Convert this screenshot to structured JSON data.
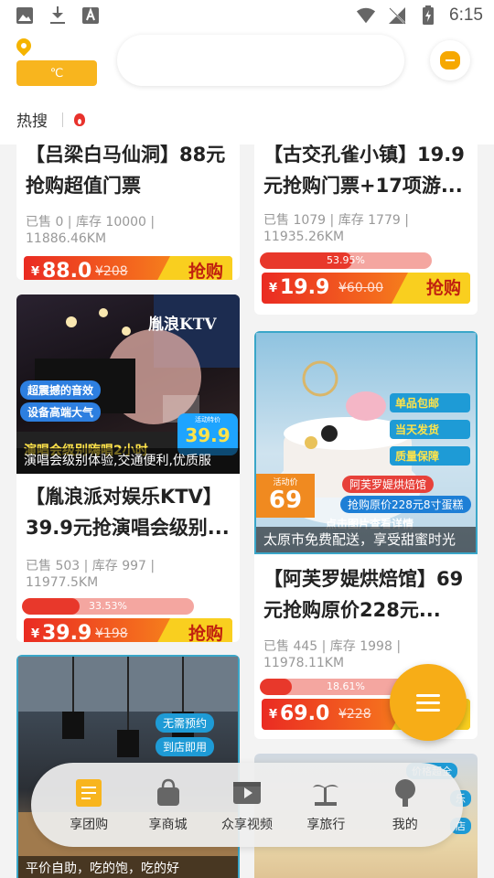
{
  "status_bar": {
    "time": "6:15"
  },
  "header": {
    "weather": "℃",
    "search_placeholder": "",
    "hot_label": "热搜"
  },
  "cards": [
    {
      "title": "【吕梁白马仙洞】88元抢购超值门票",
      "stats": "已售 0 | 库存 10000 | 11886.46KM",
      "currency": "¥",
      "price": "88.0",
      "original_price": "¥208",
      "buy_label": "抢购"
    },
    {
      "title": "【古交孔雀小镇】19.9元抢购门票+17项游...",
      "stats": "已售 1079 | 库存 1779 | 11935.26KM",
      "progress_label": "53.95%",
      "progress": 0.5395,
      "currency": "¥",
      "price": "19.9",
      "original_price": "¥60.00",
      "buy_label": "抢购"
    },
    {
      "caption": "演唱会级别体验,交通便利,优质服",
      "title": "【胤浪派对娱乐KTV】39.9元抢演唱会级别...",
      "stats": "已售 503 | 库存 997 | 11977.5KM",
      "progress_label": "33.53%",
      "progress": 0.3353,
      "currency": "¥",
      "price": "39.9",
      "original_price": "¥198",
      "buy_label": "抢购",
      "image": {
        "brand": "胤浪KTV",
        "tag1": "超震撼的音效",
        "tag2": "设备高端大气",
        "promo_label": "活动特价",
        "promo_price": "39.9",
        "bottom_text": "演唱会级别嗨唱2小时"
      }
    },
    {
      "caption": "太原市免费配送，享受甜蜜时光",
      "title": "【阿芙罗媞烘焙馆】69元抢购原价228元...",
      "stats": "已售 445 | 库存 1998 | 11978.11KM",
      "progress_label": "18.61%",
      "progress": 0.1861,
      "currency": "¥",
      "price": "69.0",
      "original_price": "¥228",
      "buy_label": "抢购",
      "image": {
        "feature1": "单品包邮",
        "feature2": "当天发货",
        "feature3": "质量保障",
        "shop_name": "阿芙罗媞烘焙馆",
        "promo_label": "活动价",
        "promo_price": "69",
        "deal_text": "抢购原价228元8寸蛋糕",
        "cta_text": "点击图片查看详情"
      }
    },
    {
      "caption": "平价自助，吃的饱，吃的好",
      "image": {
        "tag1": "无需预约",
        "tag2": "到店即用"
      }
    },
    {
      "image": {
        "tag1": "价格超全",
        "tag2": "乐",
        "tag3": "店"
      }
    }
  ],
  "bottom_nav": [
    {
      "label": "享团购",
      "icon": "ticket-icon",
      "active": true
    },
    {
      "label": "享商城",
      "icon": "shopping-bag-icon",
      "active": false
    },
    {
      "label": "众享视频",
      "icon": "video-icon",
      "active": false
    },
    {
      "label": "享旅行",
      "icon": "palm-tree-icon",
      "active": false
    },
    {
      "label": "我的",
      "icon": "profile-icon",
      "active": false
    }
  ],
  "colors": {
    "accent": "#f7ad17",
    "price_bar_start": "#ea2b22",
    "price_bar_end": "#f7a718",
    "buy_button": "#f9cf1f",
    "progress_fill": "#e8382b"
  }
}
